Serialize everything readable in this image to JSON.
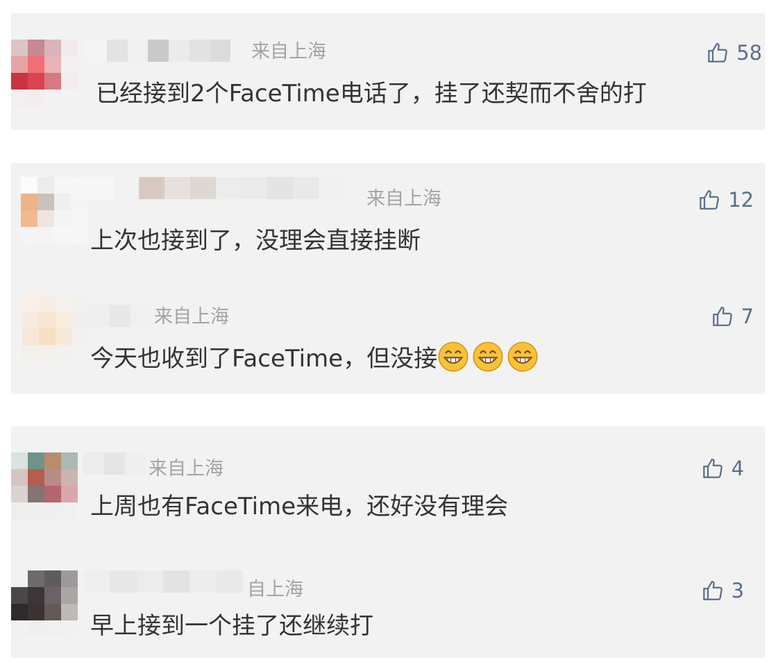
{
  "comments": [
    {
      "location": "来自上海",
      "text": "已经接到2个FaceTime电话了，挂了还契而不舍的打",
      "likes": "58",
      "like_icon": "thumbs-up-outline-icon",
      "avatar_colors": [
        "#dcc3c5",
        "#c98893",
        "#dbb3b8",
        "#f2eaea",
        "#e9a3a6",
        "#ef6f74",
        "#e8b2b6",
        "#f5f0f0",
        "#c9343f",
        "#d94450",
        "#d57a82",
        "#f4ecec",
        "#f3efef",
        "#f3eeee",
        "#f4f1f1",
        "#f4f2f2"
      ]
    },
    {
      "location": "来自上海",
      "text": "上次也接到了，没理会直接挂断",
      "likes": "12",
      "like_icon": "thumbs-up-outline-icon",
      "avatar_colors": [
        "#fbfbfb",
        "#ececec",
        "#f6f6f6",
        "#f7f7f7",
        "#edb586",
        "#ccc0ba",
        "#efefef",
        "#f5f5f5",
        "#f3b98f",
        "#efe5df",
        "#f4f4f4",
        "#f6f6f6",
        "#f5f5f5",
        "#f4f4f4",
        "#f6f6f6",
        "#f7f7f7"
      ]
    },
    {
      "location": "来自上海",
      "text": "今天也收到了FaceTime，但没接",
      "emojis": [
        "grinning-face-emoji",
        "grinning-face-emoji",
        "grinning-face-emoji"
      ],
      "likes": "7",
      "like_icon": "thumbs-up-outline-icon",
      "avatar_colors": [
        "#faf0e8",
        "#f8ede2",
        "#f6f3ee",
        "#f3f1ee",
        "#f7ebe0",
        "#f7e6d2",
        "#f9edd9",
        "#f1efed",
        "#f6e7d7",
        "#f7dfc2",
        "#f7e9d7",
        "#f2f0ee",
        "#f3efeb",
        "#f4f0ec",
        "#f3f1ef",
        "#f2f2f2"
      ]
    },
    {
      "location": "来自上海",
      "text": "上周也有FaceTime来电，还好没有理会",
      "likes": "4",
      "like_icon": "thumbs-up-outline-icon",
      "avatar_colors": [
        "#d9e3e1",
        "#6f9389",
        "#b98c6c",
        "#aab9b2",
        "#d5c4bf",
        "#b35e50",
        "#b78d86",
        "#cdb3b2",
        "#d9d3d2",
        "#857470",
        "#b5656f",
        "#dba7ab",
        "#f0eded",
        "#f0eeee",
        "#f0eeee",
        "#f1f0f0"
      ]
    },
    {
      "location": "自上海",
      "text": "早上接到一个挂了还继续打",
      "likes": "3",
      "like_icon": "thumbs-up-outline-icon",
      "avatar_colors": [
        "#f2f2f2",
        "#6e6a6c",
        "#5d5d5d",
        "#9d9a9a",
        "#4b4648",
        "#3d3538",
        "#6b6166",
        "#aaa6a6",
        "#2f2a2b",
        "#3b3332",
        "#645a55",
        "#bebab8",
        "#f1f1f1",
        "#efefef",
        "#f0f0f0",
        "#f1f1f1"
      ]
    }
  ],
  "colors": {
    "card_bg": "#f2f2f2",
    "text": "#333333",
    "location": "#a3a3a3",
    "like": "#5b6f8a"
  }
}
